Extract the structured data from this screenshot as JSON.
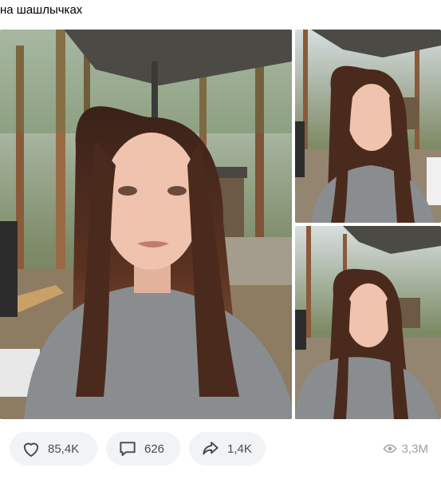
{
  "post": {
    "text": "на шашлычках"
  },
  "photos": [
    {
      "id": "main",
      "icon": "selfie-photo"
    },
    {
      "id": "top",
      "icon": "selfie-photo"
    },
    {
      "id": "bottom",
      "icon": "selfie-photo"
    }
  ],
  "actions": {
    "likes": "85,4K",
    "comments": "626",
    "shares": "1,4K",
    "views": "3,3M"
  },
  "colors": {
    "pill_bg": "#f2f3f5",
    "icon": "#4a4a4a",
    "muted": "#9aa0a6"
  }
}
